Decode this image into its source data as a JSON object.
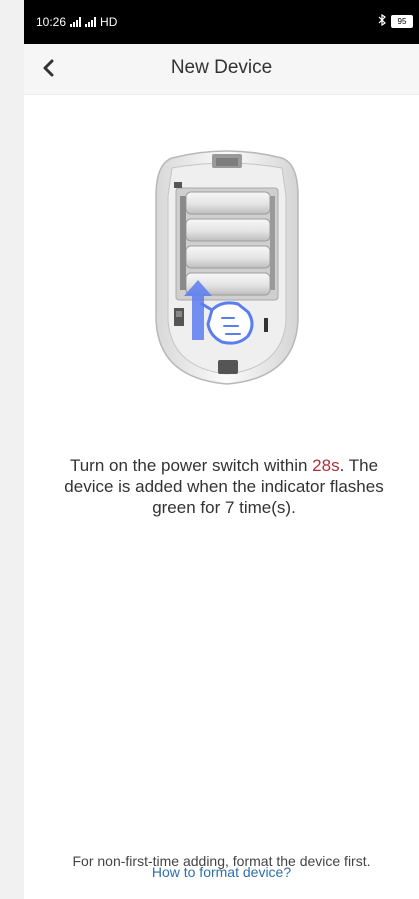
{
  "status_bar": {
    "time": "10:26",
    "network": "HD",
    "battery": "95"
  },
  "header": {
    "title": "New Device"
  },
  "instruction": {
    "prefix": "Turn on the power switch within ",
    "countdown": "28s",
    "suffix": ". The device is added when the indicator flashes green for 7 time(s)."
  },
  "footer": {
    "note": "For non-first-time adding, format the device first.",
    "help_link": "How to format device?"
  },
  "colors": {
    "countdown": "#b0303a",
    "link": "#2d6fae",
    "arrow": "#5a7df0"
  }
}
